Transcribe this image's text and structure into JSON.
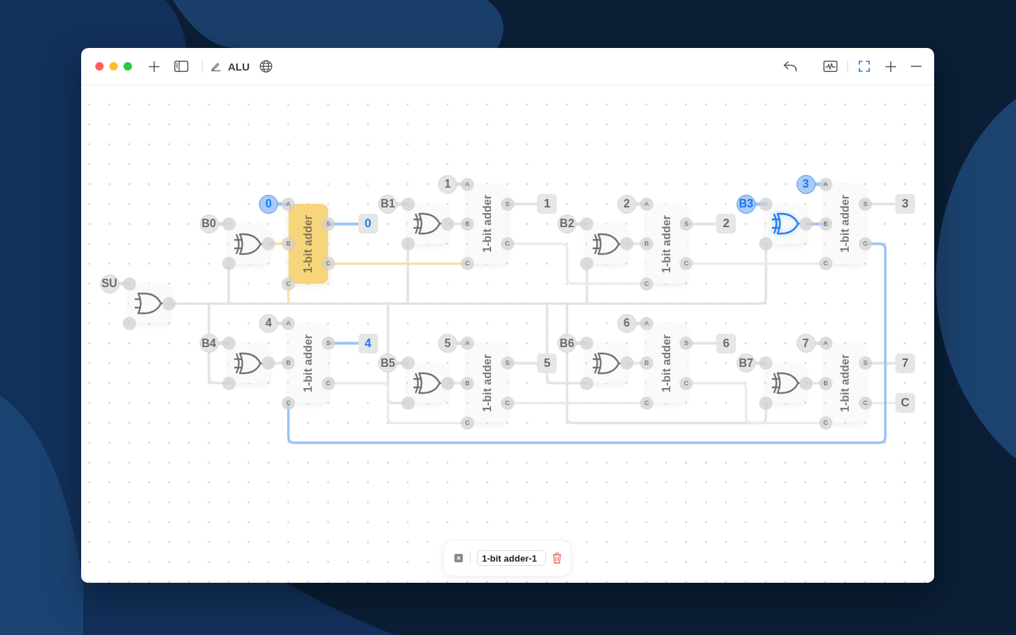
{
  "window": {
    "title": "ALU"
  },
  "circuit": {
    "control_input": {
      "label": "SU",
      "on": false
    },
    "control_gate": {
      "kind": "or",
      "active": false
    },
    "bits": [
      {
        "input_a": {
          "label": "0",
          "on": true
        },
        "input_b": {
          "label": "B0",
          "on": false
        },
        "gate": {
          "kind": "xor",
          "active": false
        },
        "adder": {
          "label": "1-bit adder",
          "selected": true,
          "carry_out": false,
          "ports": [
            "A",
            "B",
            "C",
            "S",
            "C"
          ]
        },
        "output": {
          "label": "0",
          "on": true
        }
      },
      {
        "input_a": {
          "label": "1",
          "on": false
        },
        "input_b": {
          "label": "B1",
          "on": false
        },
        "gate": {
          "kind": "xor",
          "active": false
        },
        "adder": {
          "label": "1-bit adder",
          "selected": false,
          "carry_out": false,
          "ports": [
            "A",
            "B",
            "C",
            "S",
            "C"
          ]
        },
        "output": {
          "label": "1",
          "on": false
        }
      },
      {
        "input_a": {
          "label": "2",
          "on": false
        },
        "input_b": {
          "label": "B2",
          "on": false
        },
        "gate": {
          "kind": "xor",
          "active": false
        },
        "adder": {
          "label": "1-bit adder",
          "selected": false,
          "carry_out": false,
          "ports": [
            "A",
            "B",
            "C",
            "S",
            "C"
          ]
        },
        "output": {
          "label": "2",
          "on": false
        }
      },
      {
        "input_a": {
          "label": "3",
          "on": true
        },
        "input_b": {
          "label": "B3",
          "on": true
        },
        "gate": {
          "kind": "xor",
          "active": true
        },
        "adder": {
          "label": "1-bit adder",
          "selected": false,
          "carry_out": true,
          "ports": [
            "A",
            "B",
            "C",
            "S",
            "C"
          ]
        },
        "output": {
          "label": "3",
          "on": false
        }
      },
      {
        "input_a": {
          "label": "4",
          "on": false
        },
        "input_b": {
          "label": "B4",
          "on": false
        },
        "gate": {
          "kind": "xor",
          "active": false
        },
        "adder": {
          "label": "1-bit adder",
          "selected": false,
          "carry_out": false,
          "ports": [
            "A",
            "B",
            "C",
            "S",
            "C"
          ]
        },
        "output": {
          "label": "4",
          "on": true
        }
      },
      {
        "input_a": {
          "label": "5",
          "on": false
        },
        "input_b": {
          "label": "B5",
          "on": false
        },
        "gate": {
          "kind": "xor",
          "active": false
        },
        "adder": {
          "label": "1-bit adder",
          "selected": false,
          "carry_out": false,
          "ports": [
            "A",
            "B",
            "C",
            "S",
            "C"
          ]
        },
        "output": {
          "label": "5",
          "on": false
        }
      },
      {
        "input_a": {
          "label": "6",
          "on": false
        },
        "input_b": {
          "label": "B6",
          "on": false
        },
        "gate": {
          "kind": "xor",
          "active": false
        },
        "adder": {
          "label": "1-bit adder",
          "selected": false,
          "carry_out": false,
          "ports": [
            "A",
            "B",
            "C",
            "S",
            "C"
          ]
        },
        "output": {
          "label": "6",
          "on": false
        }
      },
      {
        "input_a": {
          "label": "7",
          "on": false
        },
        "input_b": {
          "label": "B7",
          "on": false
        },
        "gate": {
          "kind": "xor",
          "active": false
        },
        "adder": {
          "label": "1-bit adder",
          "selected": false,
          "carry_out": false,
          "ports": [
            "A",
            "B",
            "C",
            "S",
            "C"
          ]
        },
        "output": {
          "label": "7",
          "on": false
        }
      }
    ],
    "carry_output": {
      "label": "C",
      "on": false
    }
  },
  "selection_bar": {
    "name": "1-bit adder-1"
  }
}
